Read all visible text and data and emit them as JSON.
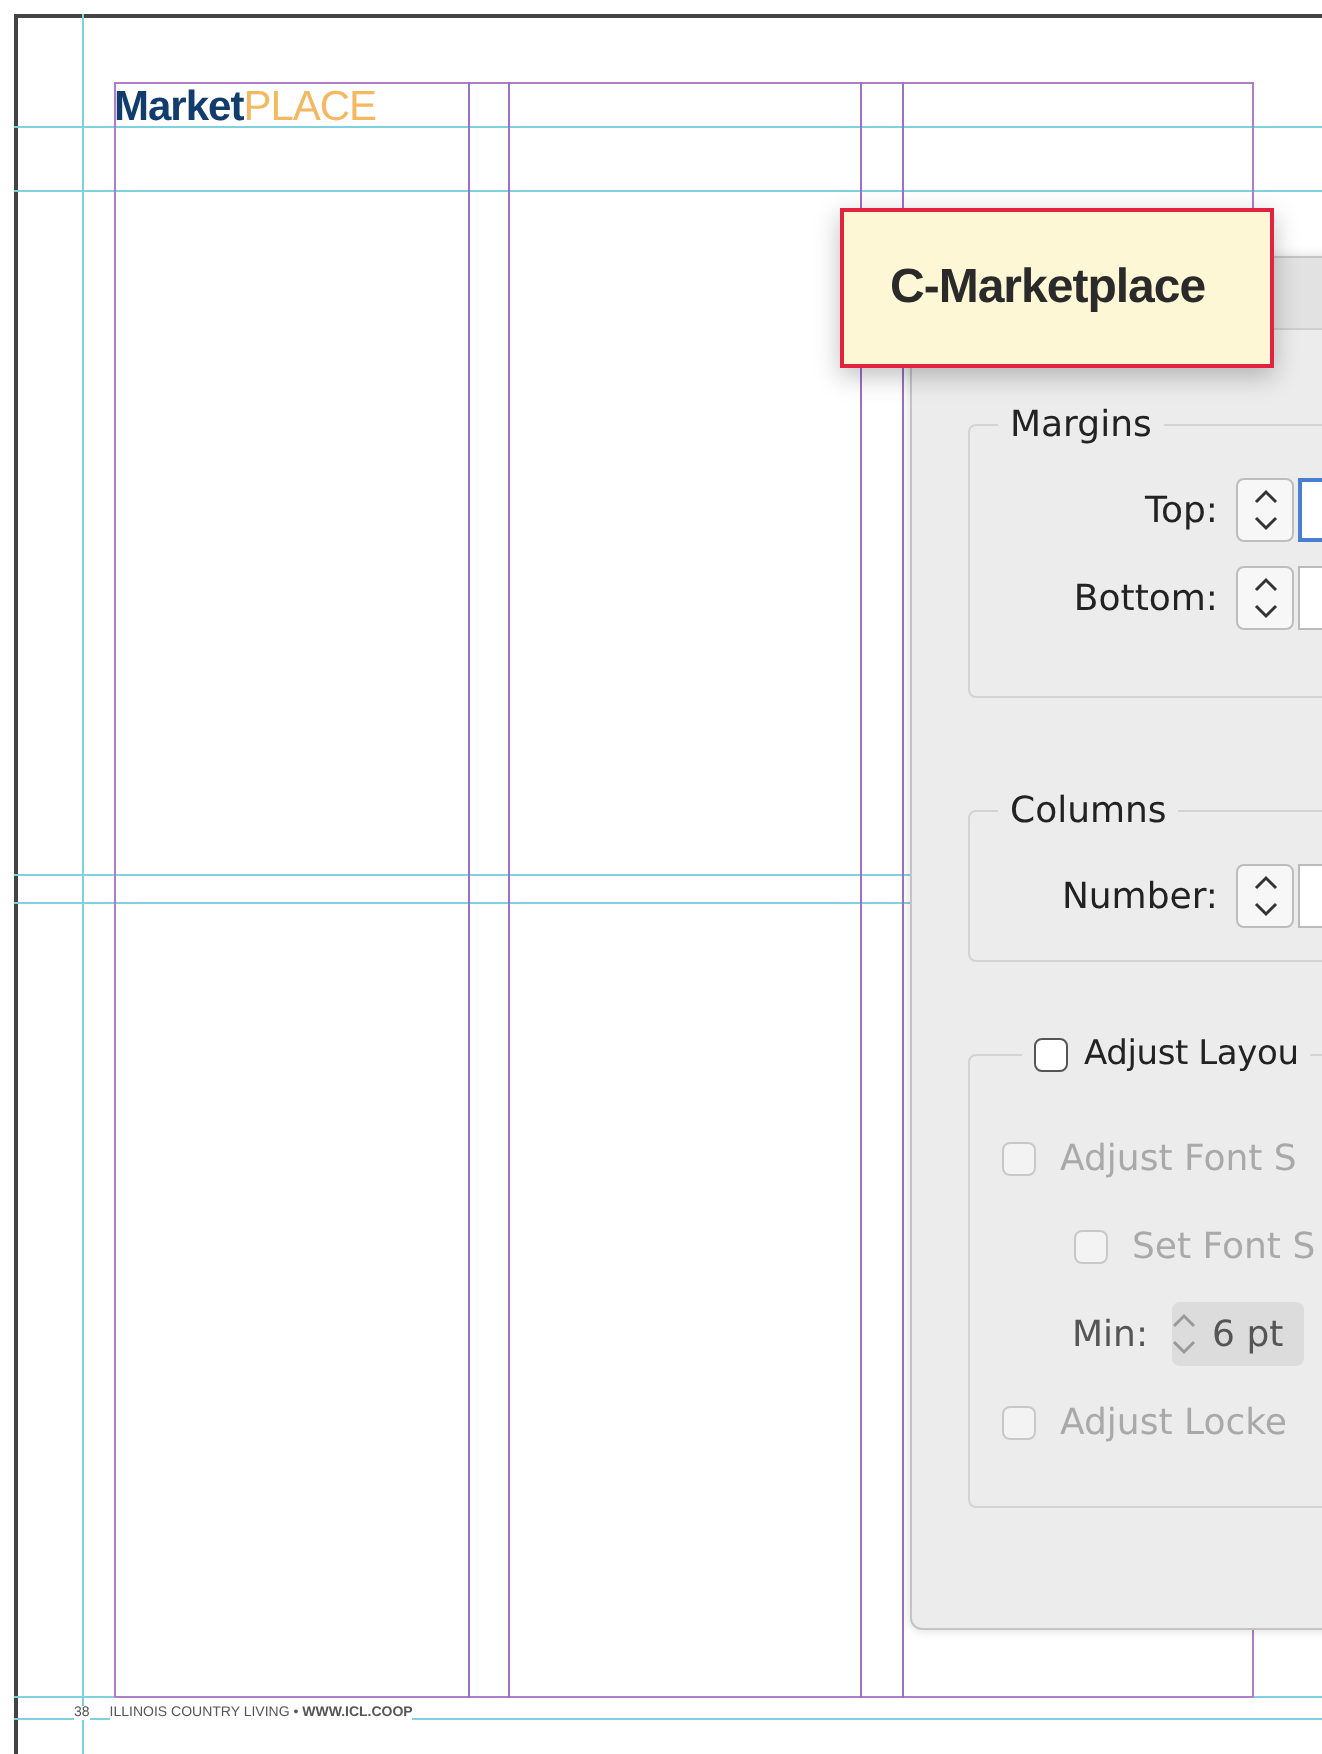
{
  "page": {
    "logo": "**Market**PLACE",
    "folio": "38",
    "footer": "ILLINOIS COUNTRY LIVING • **WWW.ICL.COOP**"
  },
  "tooltip": {
    "text": "C-Marketplace"
  },
  "dialog": {
    "groups": [
      {
        "title": "Margins",
        "fields": [
          {
            "label": "Top:",
            "focused": true
          },
          {
            "label": "Bottom:",
            "focused": false
          }
        ]
      },
      {
        "title": "Columns",
        "fields": [
          {
            "label": "Number:",
            "focused": false
          }
        ]
      }
    ],
    "adjust_layout": {
      "label": "Adjust Layou",
      "checked": false,
      "options": [
        {
          "kind": "checkbox",
          "label": "Adjust Font S",
          "checked": false,
          "disabled": true,
          "children": [
            {
              "kind": "checkbox",
              "label": "Set Font S",
              "checked": false,
              "disabled": true
            },
            {
              "kind": "stepper",
              "label": "Min:",
              "value": "6 pt",
              "disabled": true
            }
          ]
        },
        {
          "kind": "checkbox",
          "label": "Adjust Locke",
          "checked": false,
          "disabled": true
        }
      ]
    }
  }
}
